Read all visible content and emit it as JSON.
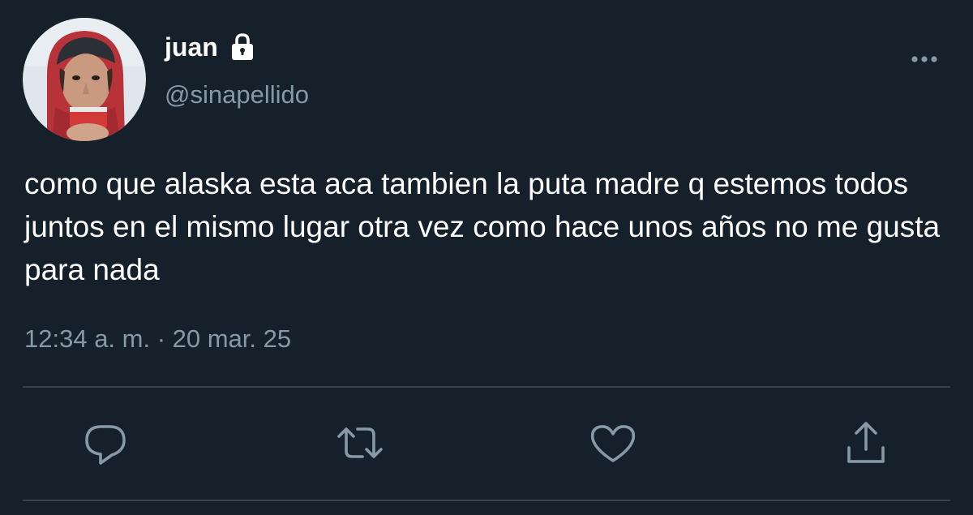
{
  "tweet": {
    "display_name": "juan",
    "handle": "@sinapellido",
    "text": "como que alaska esta aca tambien la puta madre q estemos todos juntos en el mismo lugar otra vez como hace unos años no me gusta para nada",
    "timestamp": "12:34 a. m. · 20 mar. 25",
    "protected": true
  },
  "icons": {
    "lock": "lock-icon",
    "more": "more-options-icon",
    "reply": "reply-icon",
    "retweet": "retweet-icon",
    "like": "heart-icon",
    "share": "share-icon"
  },
  "colors": {
    "background": "#15202b",
    "primary_text": "#ffffff",
    "secondary_text": "#8899a6",
    "divider": "#38444d"
  }
}
